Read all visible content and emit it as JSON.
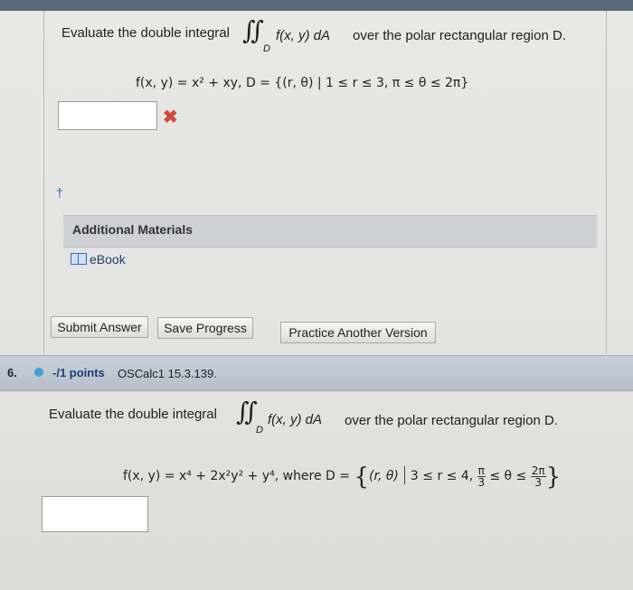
{
  "q5": {
    "prompt_before": "Evaluate the double integral",
    "integral_symbol": "∬",
    "integral_sub": "D",
    "integrand": "f(x, y) dA",
    "prompt_after": "over the polar rectangular region D.",
    "function_line": "f(x, y) = x² + xy, D = {(r, θ) | 1 ≤ r ≤ 3, π ≤ θ ≤ 2π}",
    "answer_value": "",
    "status_mark": "✖",
    "dagger": "†"
  },
  "additional_materials": {
    "heading": "Additional Materials",
    "ebook_label": "eBook"
  },
  "actions": {
    "submit": "Submit Answer",
    "save": "Save Progress",
    "practice": "Practice Another Version"
  },
  "q6": {
    "number": "6.",
    "points": "-/1 points",
    "source": "OSCalc1 15.3.139.",
    "prompt_before": "Evaluate the double integral",
    "integral_symbol": "∬",
    "integral_sub": "D",
    "integrand": "f(x, y) dA",
    "prompt_after": "over the polar rectangular region D.",
    "function_text": "f(x, y) = x⁴ + 2x²y² + y⁴, where D =",
    "brace_open": "{",
    "brace_close": "}",
    "pair": "(r, θ)",
    "cond1": "3 ≤ r ≤ 4,",
    "frac1_num": "π",
    "frac1_den": "3",
    "mid": "≤ θ ≤",
    "frac2_num": "2π",
    "frac2_den": "3",
    "answer_value": ""
  },
  "colors": {
    "header_bar": "#5a6a7a",
    "question_header": "#b6bfca",
    "incorrect": "#d24b3a",
    "link": "#1e3e66"
  }
}
